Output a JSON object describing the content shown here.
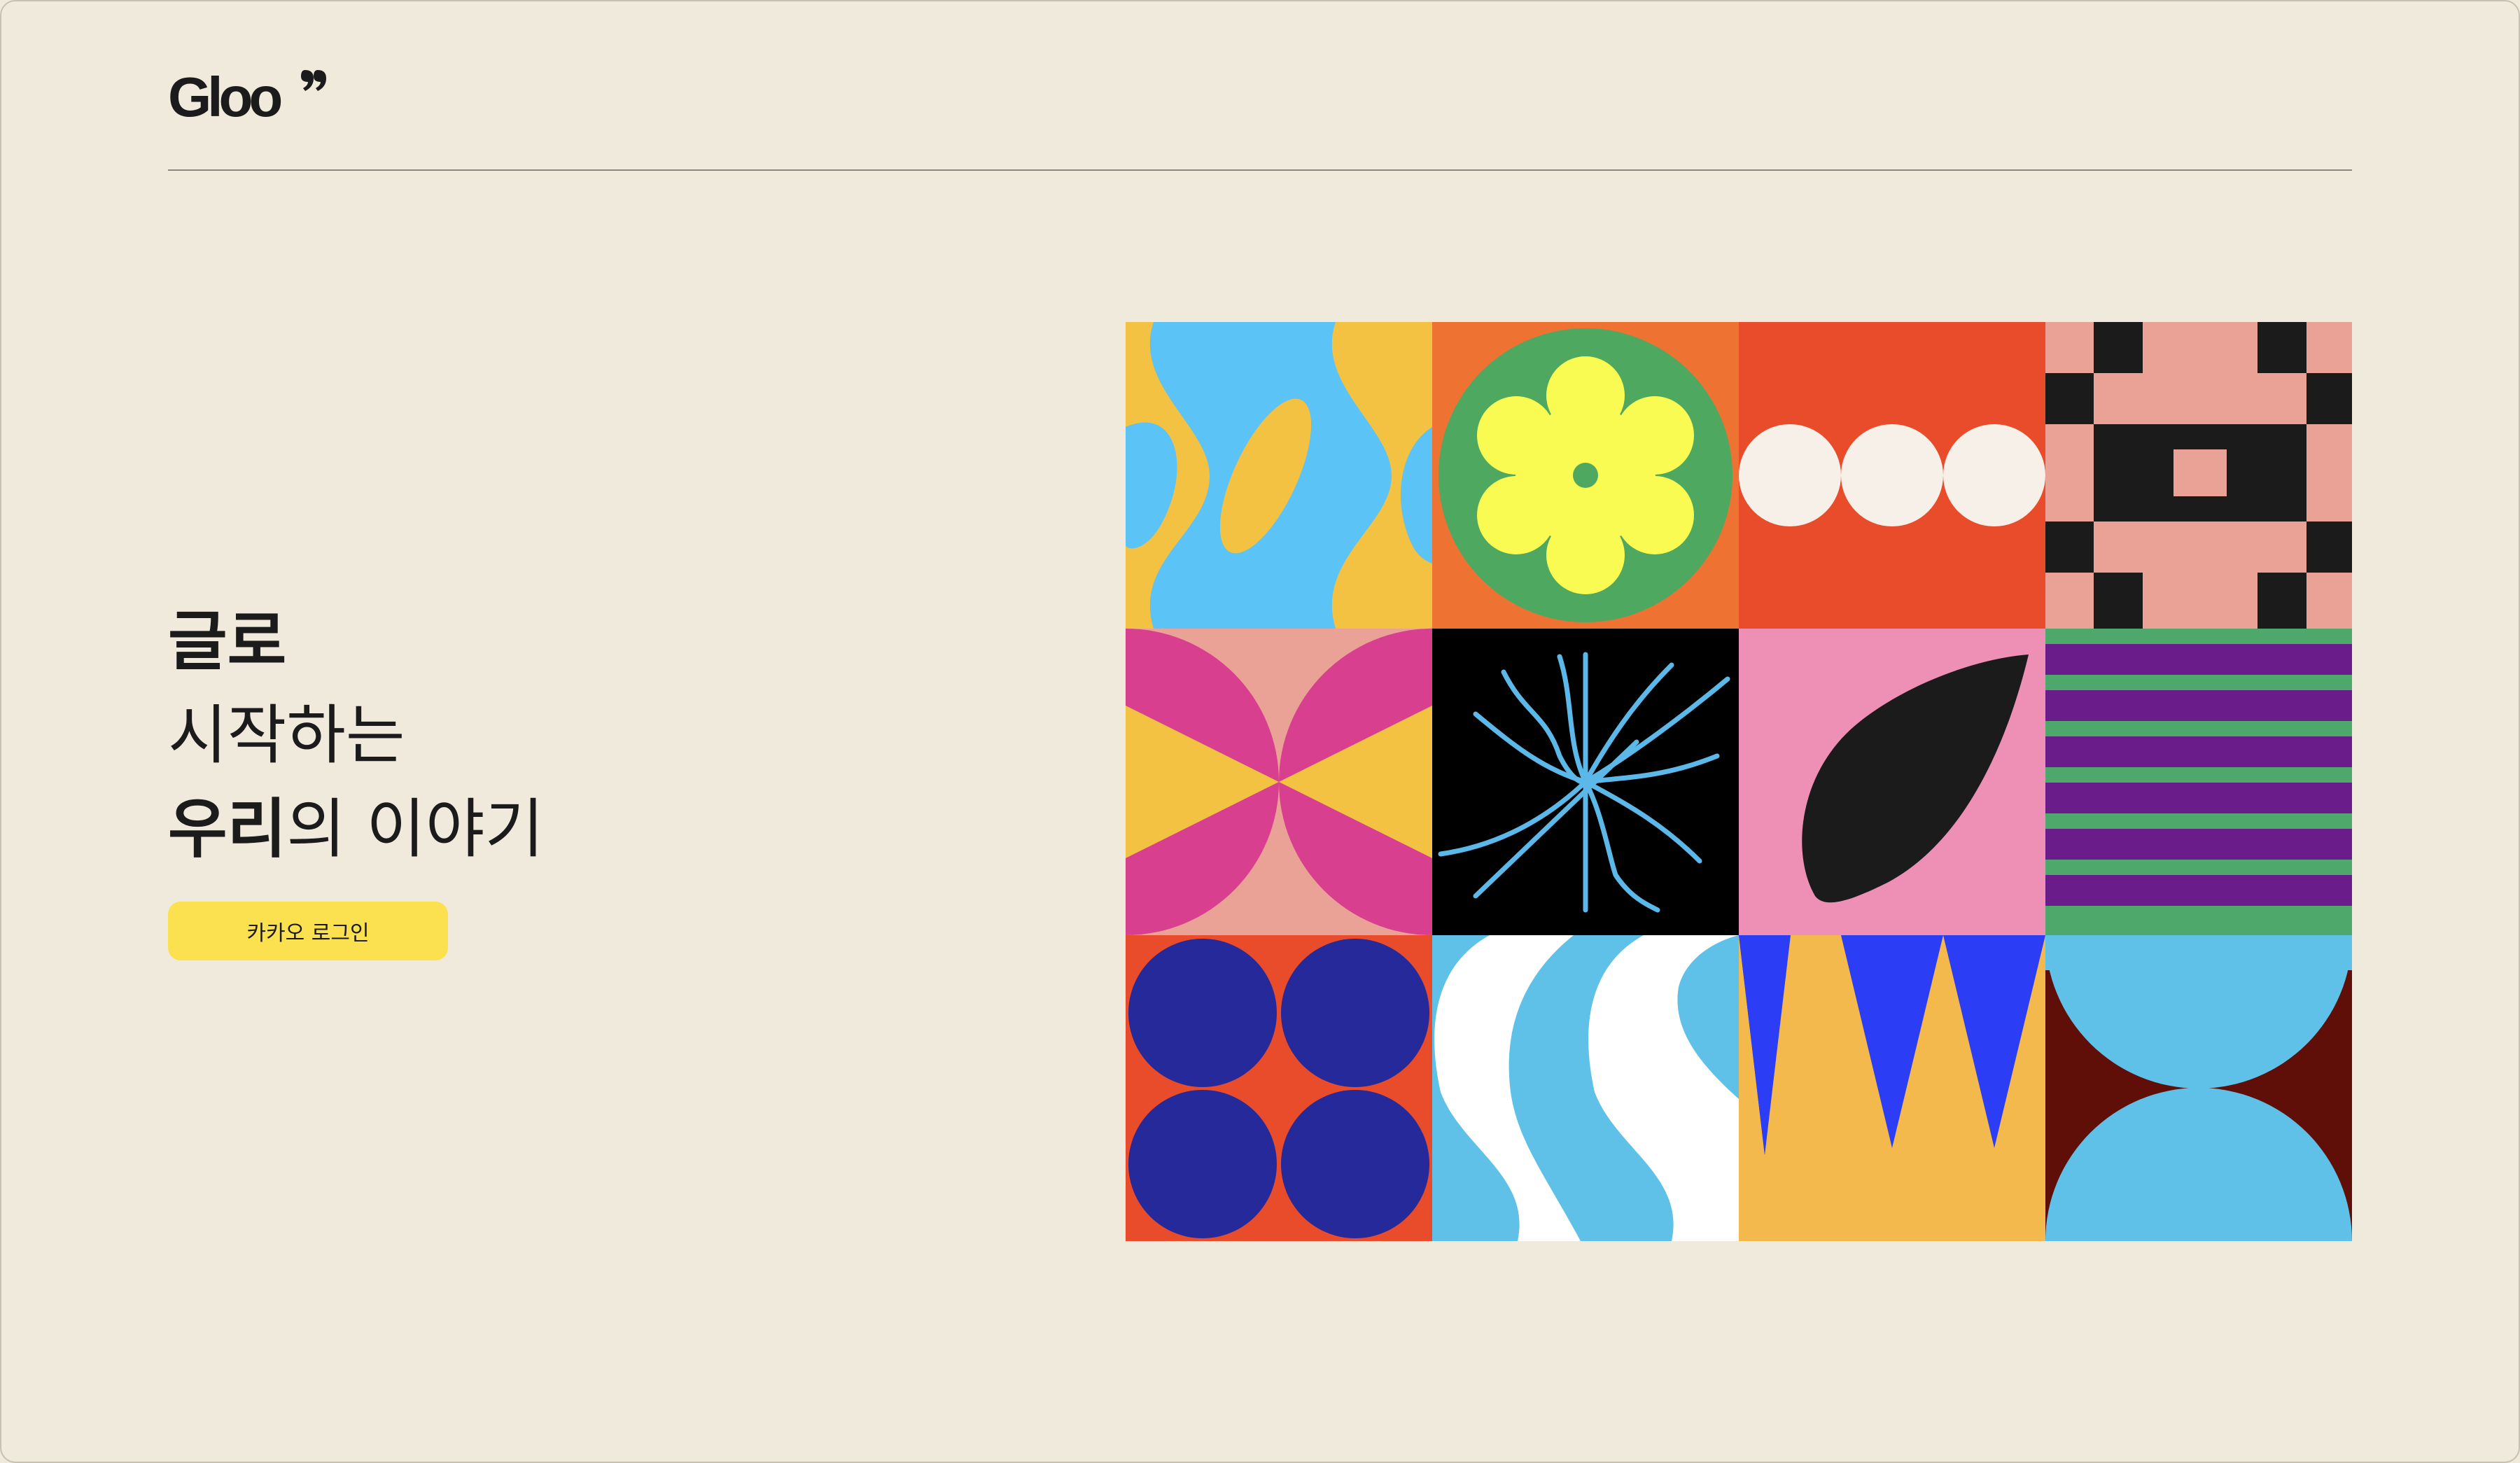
{
  "brand": {
    "logo_text": "Gloo"
  },
  "hero": {
    "line1": "글로",
    "line2": "시작하는",
    "line3_bold": "우리",
    "line3_regular": "의 이야기"
  },
  "login": {
    "kakao_label": "카카오 로그인",
    "button_color": "#fbe04f"
  },
  "artwork": {
    "tiles": [
      "wavy-blue-yellow-tile",
      "flower-tile",
      "three-circles-tile",
      "checker-tile",
      "bowtie-tile",
      "starburst-tile",
      "leaf-tile",
      "stripes-tile",
      "four-circles-tile",
      "waves-tile",
      "zigzag-tile",
      "half-circles-tile"
    ]
  },
  "colors": {
    "background": "#f0eadc",
    "text": "#1b1b1b"
  }
}
